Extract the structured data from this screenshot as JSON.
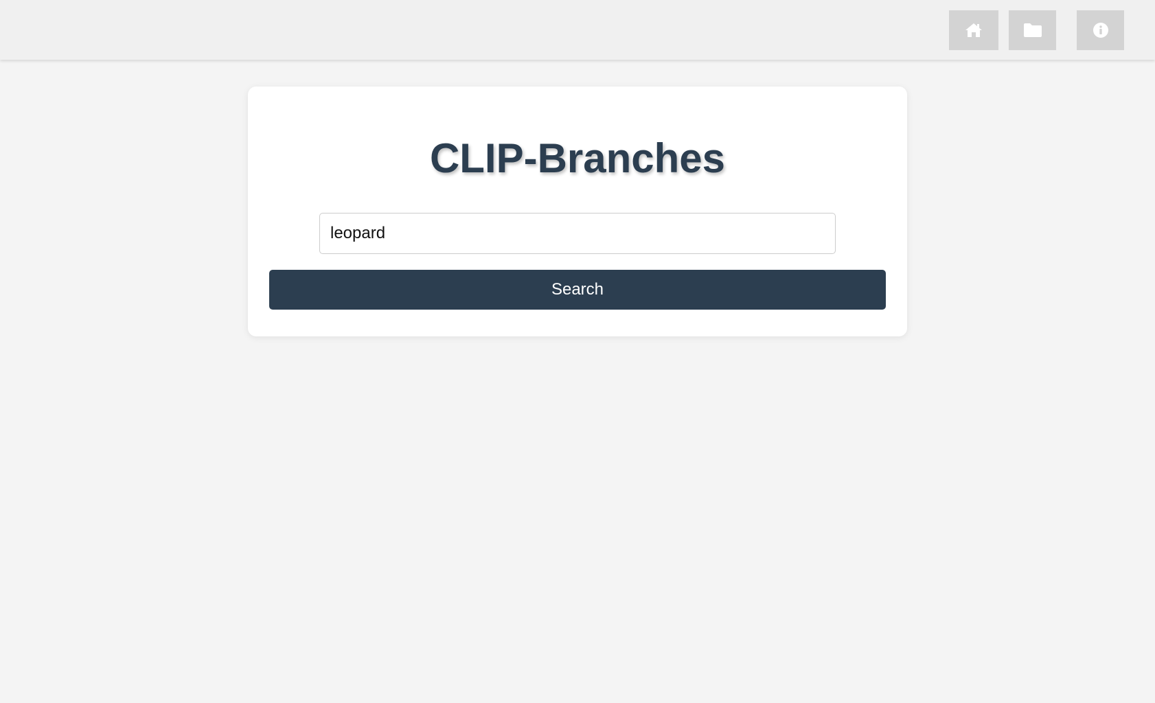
{
  "nav": {
    "items": [
      {
        "icon": "home-icon",
        "label": "Home"
      },
      {
        "icon": "folder-icon",
        "label": "Folder"
      },
      {
        "icon": "info-icon",
        "label": "Info"
      }
    ]
  },
  "main": {
    "title": "CLIP-Branches",
    "search": {
      "value": "leopard",
      "placeholder": ""
    },
    "search_button_label": "Search"
  },
  "colors": {
    "accent": "#2c3e50",
    "background": "#f4f4f4",
    "topbar": "#f0f0f0",
    "nav_button": "#d3d3d3"
  }
}
